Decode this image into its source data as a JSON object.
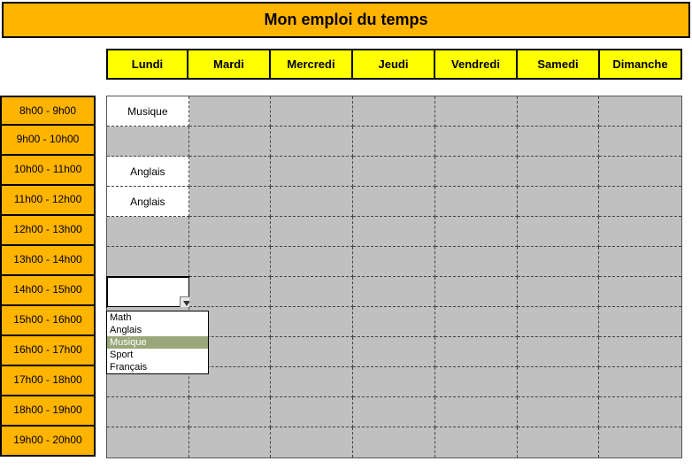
{
  "title": "Mon emploi du temps",
  "days": [
    "Lundi",
    "Mardi",
    "Mercredi",
    "Jeudi",
    "Vendredi",
    "Samedi",
    "Dimanche"
  ],
  "times": [
    "8h00 - 9h00",
    "9h00 - 10h00",
    "10h00 - 11h00",
    "11h00 - 12h00",
    "12h00 - 13h00",
    "13h00 - 14h00",
    "14h00 - 15h00",
    "15h00 - 16h00",
    "16h00 - 17h00",
    "17h00 - 18h00",
    "18h00 - 19h00",
    "19h00 - 20h00"
  ],
  "entries": {
    "0": {
      "0": "Musique",
      "2": "Anglais",
      "3": "Anglais"
    }
  },
  "active_cell": {
    "row": 6,
    "col": 0
  },
  "dropdown": {
    "options": [
      "Math",
      "Anglais",
      "Musique",
      "Sport",
      "Français"
    ],
    "selected_index": 2
  }
}
